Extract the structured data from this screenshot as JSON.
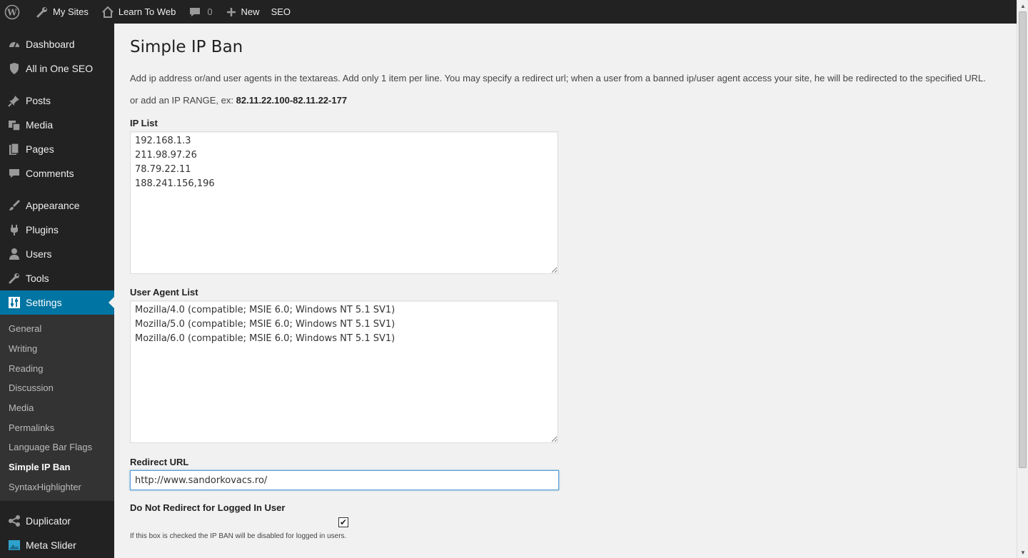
{
  "adminbar": {
    "wp_logo": "wordpress-icon",
    "my_sites": "My Sites",
    "site_name": "Learn To Web",
    "comments_count": "0",
    "new_label": "New",
    "seo_label": "SEO"
  },
  "sidebar": {
    "items_top": [
      {
        "label": "Dashboard",
        "icon": "dashboard-icon"
      },
      {
        "label": "All in One SEO",
        "icon": "shield-icon"
      }
    ],
    "items_content": [
      {
        "label": "Posts",
        "icon": "pin-icon"
      },
      {
        "label": "Media",
        "icon": "media-icon"
      },
      {
        "label": "Pages",
        "icon": "pages-icon"
      },
      {
        "label": "Comments",
        "icon": "comment-icon"
      }
    ],
    "items_admin": [
      {
        "label": "Appearance",
        "icon": "brush-icon"
      },
      {
        "label": "Plugins",
        "icon": "plug-icon"
      },
      {
        "label": "Users",
        "icon": "user-icon"
      },
      {
        "label": "Tools",
        "icon": "wrench-icon"
      },
      {
        "label": "Settings",
        "icon": "sliders-icon"
      }
    ],
    "settings_submenu": [
      "General",
      "Writing",
      "Reading",
      "Discussion",
      "Media",
      "Permalinks",
      "Language Bar Flags",
      "Simple IP Ban",
      "SyntaxHighlighter"
    ],
    "current_submenu": "Simple IP Ban",
    "items_bottom": [
      {
        "label": "Duplicator",
        "icon": "share-icon"
      },
      {
        "label": "Meta Slider",
        "icon": "image-icon"
      }
    ]
  },
  "page": {
    "title": "Simple IP Ban",
    "description": "Add ip address or/and user agents in the textareas. Add only 1 item per line. You may specify a redirect url; when a user from a banned ip/user agent access your site, he will be redirected to the specified URL.",
    "range_prefix": "or add an IP RANGE, ex: ",
    "range_example": "82.11.22.100-82.11.22-177",
    "ip_list_label": "IP List",
    "ip_list_value": "192.168.1.3\n211.98.97.26\n78.79.22.11\n188.241.156,196",
    "ua_list_label": "User Agent List",
    "ua_list_value": "Mozilla/4.0 (compatible; MSIE 6.0; Windows NT 5.1 SV1)\nMozilla/5.0 (compatible; MSIE 6.0; Windows NT 5.1 SV1)\nMozilla/6.0 (compatible; MSIE 6.0; Windows NT 5.1 SV1)",
    "redirect_label": "Redirect URL",
    "redirect_value": "http://www.sandorkovacs.ro/",
    "noredirect_label": "Do Not Redirect for Logged In User",
    "noredirect_checked": true,
    "noredirect_hint": "If this box is checked the IP BAN will be disabled for logged in users."
  },
  "colors": {
    "adminbar_bg": "#222222",
    "sidebar_bg": "#222222",
    "submenu_bg": "#333333",
    "accent": "#0074a2",
    "content_bg": "#f1f1f1"
  }
}
